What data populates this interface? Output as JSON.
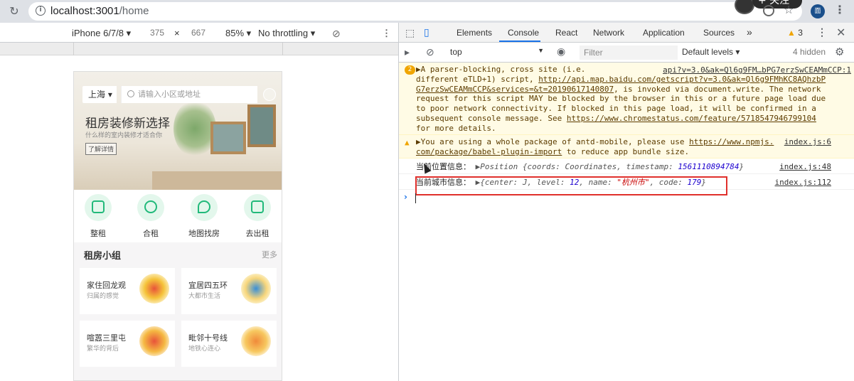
{
  "browser": {
    "url_host": "localhost:3001",
    "url_path": "/home",
    "follow_badge": "+ 关注"
  },
  "device_toolbar": {
    "device": "iPhone 6/7/8 ▾",
    "width": "375",
    "times": "×",
    "height": "667",
    "zoom": "85% ▾",
    "throttle": "No throttling ▾"
  },
  "app": {
    "city": "上海 ▾",
    "search_placeholder": "请输入小区或地址",
    "banner_title": "租房装修新选择",
    "banner_sub": "什么样的室内装修才适合你",
    "banner_button": "了解详情",
    "nav": [
      "整租",
      "合租",
      "地图找房",
      "去出租"
    ],
    "groups_title": "租房小组",
    "groups_more": "更多",
    "groups": [
      {
        "name": "家住回龙观",
        "desc": "归属的感觉",
        "color": "#f5c33a"
      },
      {
        "name": "宜居四五环",
        "desc": "大都市生活",
        "color": "#f7d67c"
      },
      {
        "name": "喧嚣三里屯",
        "desc": "繁华的背后",
        "color": "#f5b942"
      },
      {
        "name": "毗邻十号线",
        "desc": "地铁心连心",
        "color": "#f7c860"
      }
    ],
    "accent": "#21b97a"
  },
  "devtools": {
    "tabs": [
      "Elements",
      "Console",
      "React",
      "Network",
      "Application",
      "Sources",
      "»"
    ],
    "active_tab": "Console",
    "warning_count": "3",
    "context": "top",
    "filter_placeholder": "Filter",
    "levels": "Default levels ▾",
    "hidden": "4 hidden",
    "messages": {
      "m1_badge": "2",
      "m1_src": "api?v=3.0&ak=Ql6g9FM…bPG7erzSwCEAMmCCP:1",
      "m1_l1": "▶A parser-blocking, cross site (i.e.",
      "m1_l2a": "different eTLD+1) script, ",
      "m1_l2b": "http://api.map.baidu.com/getscript?v=3.0&ak=Ql6g9FMhKC8AQhzbP",
      "m1_l3a": "G7erzSwCEAMmCCP&services=&t=20190617140807",
      "m1_l3b": ", is invoked via document.write. The network",
      "m1_l4": "request for this script MAY be blocked by the browser in this or a future page load due",
      "m1_l5": "to poor network connectivity. If blocked in this page load, it will be confirmed in a",
      "m1_l6a": "subsequent console message. See ",
      "m1_l6b": "https://www.chromestatus.com/feature/5718547946799104",
      "m1_l7": "for more details.",
      "m2_l1a": "▶You are using a whole package of antd-mobile, please use ",
      "m2_l1b": "https://www.npmjs.",
      "m2_l2a": "com/package/babel-plugin-import",
      "m2_l2b": " to reduce app bundle size.",
      "m2_src": "index.js:6",
      "m3_label": "当前位置信息：",
      "m3_obj_prefix": "▶Position {coords: Coordinates, timestamp: ",
      "m3_timestamp": "1561110894784",
      "m3_obj_suffix": "}",
      "m3_src": "index.js:48",
      "m4_label": "当前城市信息：",
      "m4_p1": "▶{center: J, level: ",
      "m4_level": "12",
      "m4_p2": ", name: ",
      "m4_name": "\"杭州市\"",
      "m4_p3": ", code: ",
      "m4_code": "179",
      "m4_p4": "}",
      "m4_src": "index.js:112"
    }
  }
}
